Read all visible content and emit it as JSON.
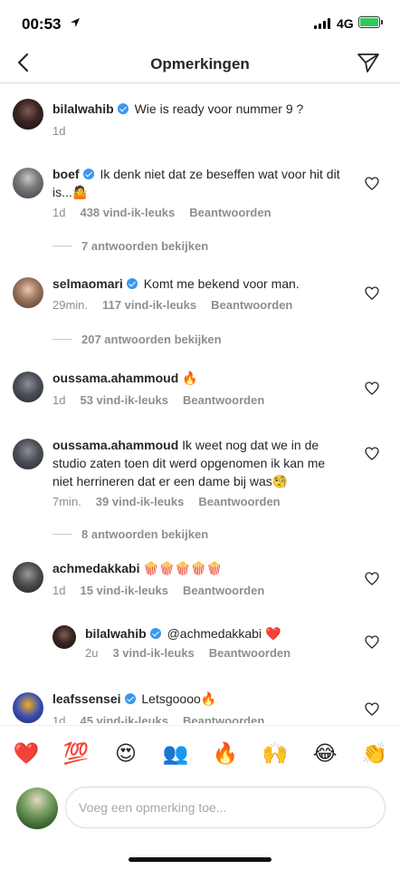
{
  "status_bar": {
    "time": "00:53",
    "network": "4G"
  },
  "header": {
    "title": "Opmerkingen"
  },
  "caption": {
    "user": "bilalwahib",
    "verified": true,
    "text": "Wie is ready voor nummer 9 ?",
    "time": "1d"
  },
  "comments": [
    {
      "user": "boef",
      "verified": true,
      "text": "Ik denk niet dat ze beseffen wat voor hit dit is...🤷",
      "time": "1d",
      "likes": "438 vind-ik-leuks",
      "reply": "Beantwoorden",
      "view_replies": "7 antwoorden bekijken"
    },
    {
      "user": "selmaomari",
      "verified": true,
      "text": "Komt me bekend voor man.",
      "time": "29min.",
      "likes": "117 vind-ik-leuks",
      "reply": "Beantwoorden",
      "view_replies": "207 antwoorden bekijken"
    },
    {
      "user": "oussama.ahammoud",
      "verified": false,
      "text": "🔥",
      "time": "1d",
      "likes": "53 vind-ik-leuks",
      "reply": "Beantwoorden"
    },
    {
      "user": "oussama.ahammoud",
      "verified": false,
      "text": "Ik weet nog dat we in de studio zaten toen dit werd opgenomen ik kan me niet herrineren dat er een dame bij was🧐",
      "time": "7min.",
      "likes": "39 vind-ik-leuks",
      "reply": "Beantwoorden",
      "view_replies": "8 antwoorden bekijken"
    },
    {
      "user": "achmedakkabi",
      "verified": false,
      "text": "🍿🍿🍿🍿🍿",
      "time": "1d",
      "likes": "15 vind-ik-leuks",
      "reply": "Beantwoorden"
    },
    {
      "user": "bilalwahib",
      "verified": true,
      "text": "@achmedakkabi ❤️",
      "time": "2u",
      "likes": "3 vind-ik-leuks",
      "reply": "Beantwoorden",
      "is_reply": true
    },
    {
      "user": "leafssensei",
      "verified": true,
      "text": "Letsgoooo🔥",
      "time": "1d",
      "likes": "45 vind-ik-leuks",
      "reply": "Beantwoorden"
    }
  ],
  "emoji_bar": [
    "❤️",
    "💯",
    "😍",
    "👥",
    "🔥",
    "🙌",
    "😂",
    "👏"
  ],
  "composer": {
    "placeholder": "Voeg een opmerking toe..."
  },
  "colors": {
    "verified": "#3897f0",
    "secondary_text": "#8e8e8e",
    "battery": "#34c759"
  },
  "icons": [
    "back-arrow-icon",
    "direct-send-icon",
    "verified-badge-icon",
    "heart-outline-icon",
    "location-arrow-icon",
    "signal-icon",
    "battery-icon"
  ]
}
